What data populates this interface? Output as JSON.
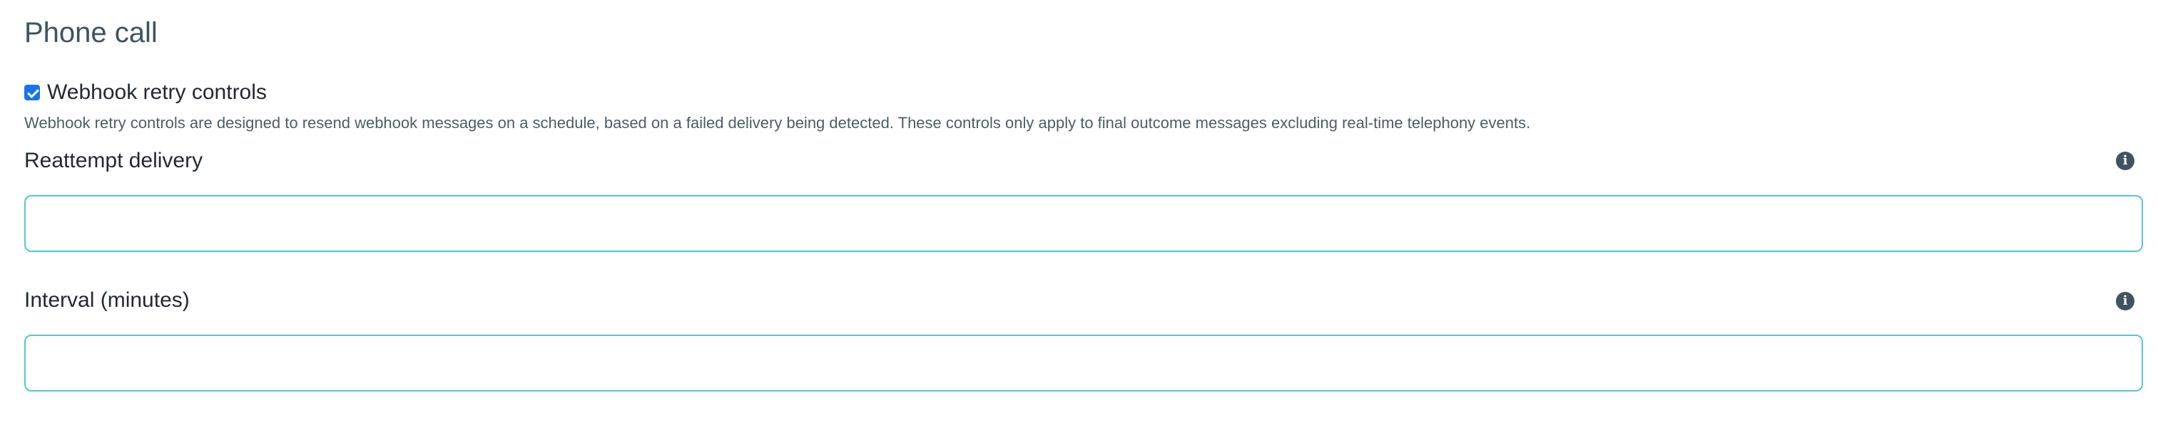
{
  "section": {
    "title": "Phone call"
  },
  "webhook_retry": {
    "checkbox_label": "Webhook retry controls",
    "checked": true,
    "help_text": "Webhook retry controls are designed to resend webhook messages on a schedule, based on a failed delivery being detected. These controls only apply to final outcome messages excluding real-time telephony events."
  },
  "fields": [
    {
      "label": "Reattempt delivery",
      "value": "",
      "info_icon": "info-icon"
    },
    {
      "label": "Interval (minutes)",
      "value": "",
      "info_icon": "info-icon"
    }
  ],
  "colors": {
    "title": "#3b5560",
    "input_border": "#52c7d6",
    "checkbox": "#1a73e8",
    "info_icon": "#3f5460"
  }
}
